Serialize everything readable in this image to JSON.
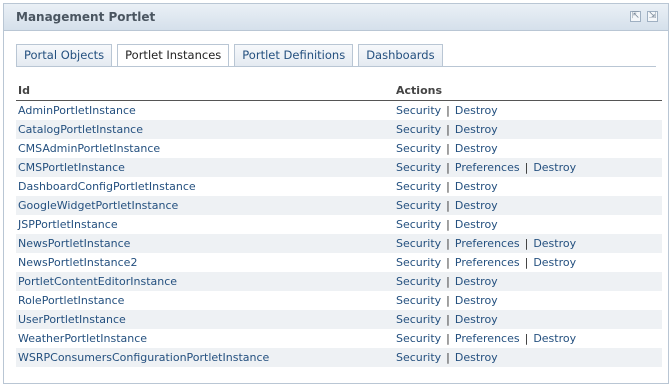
{
  "portlet": {
    "title": "Management Portlet",
    "controls": {
      "minimize": "⇱",
      "maximize": "⇲"
    }
  },
  "tabs": [
    {
      "label": "Portal Objects",
      "active": false
    },
    {
      "label": "Portlet Instances",
      "active": true
    },
    {
      "label": "Portlet Definitions",
      "active": false
    },
    {
      "label": "Dashboards",
      "active": false
    }
  ],
  "table": {
    "columns": {
      "id": "Id",
      "actions": "Actions"
    },
    "separator": "|",
    "rows": [
      {
        "id": "AdminPortletInstance",
        "actions": [
          "Security",
          "Destroy"
        ]
      },
      {
        "id": "CatalogPortletInstance",
        "actions": [
          "Security",
          "Destroy"
        ]
      },
      {
        "id": "CMSAdminPortletInstance",
        "actions": [
          "Security",
          "Destroy"
        ]
      },
      {
        "id": "CMSPortletInstance",
        "actions": [
          "Security",
          "Preferences",
          "Destroy"
        ]
      },
      {
        "id": "DashboardConfigPortletInstance",
        "actions": [
          "Security",
          "Destroy"
        ]
      },
      {
        "id": "GoogleWidgetPortletInstance",
        "actions": [
          "Security",
          "Destroy"
        ]
      },
      {
        "id": "JSPPortletInstance",
        "actions": [
          "Security",
          "Destroy"
        ]
      },
      {
        "id": "NewsPortletInstance",
        "actions": [
          "Security",
          "Preferences",
          "Destroy"
        ]
      },
      {
        "id": "NewsPortletInstance2",
        "actions": [
          "Security",
          "Preferences",
          "Destroy"
        ]
      },
      {
        "id": "PortletContentEditorInstance",
        "actions": [
          "Security",
          "Destroy"
        ]
      },
      {
        "id": "RolePortletInstance",
        "actions": [
          "Security",
          "Destroy"
        ]
      },
      {
        "id": "UserPortletInstance",
        "actions": [
          "Security",
          "Destroy"
        ]
      },
      {
        "id": "WeatherPortletInstance",
        "actions": [
          "Security",
          "Preferences",
          "Destroy"
        ]
      },
      {
        "id": "WSRPConsumersConfigurationPortletInstance",
        "actions": [
          "Security",
          "Destroy"
        ]
      }
    ]
  },
  "colors": {
    "link": "#24507f",
    "row_alt": "#eef1f4",
    "border": "#b9c6d4"
  }
}
